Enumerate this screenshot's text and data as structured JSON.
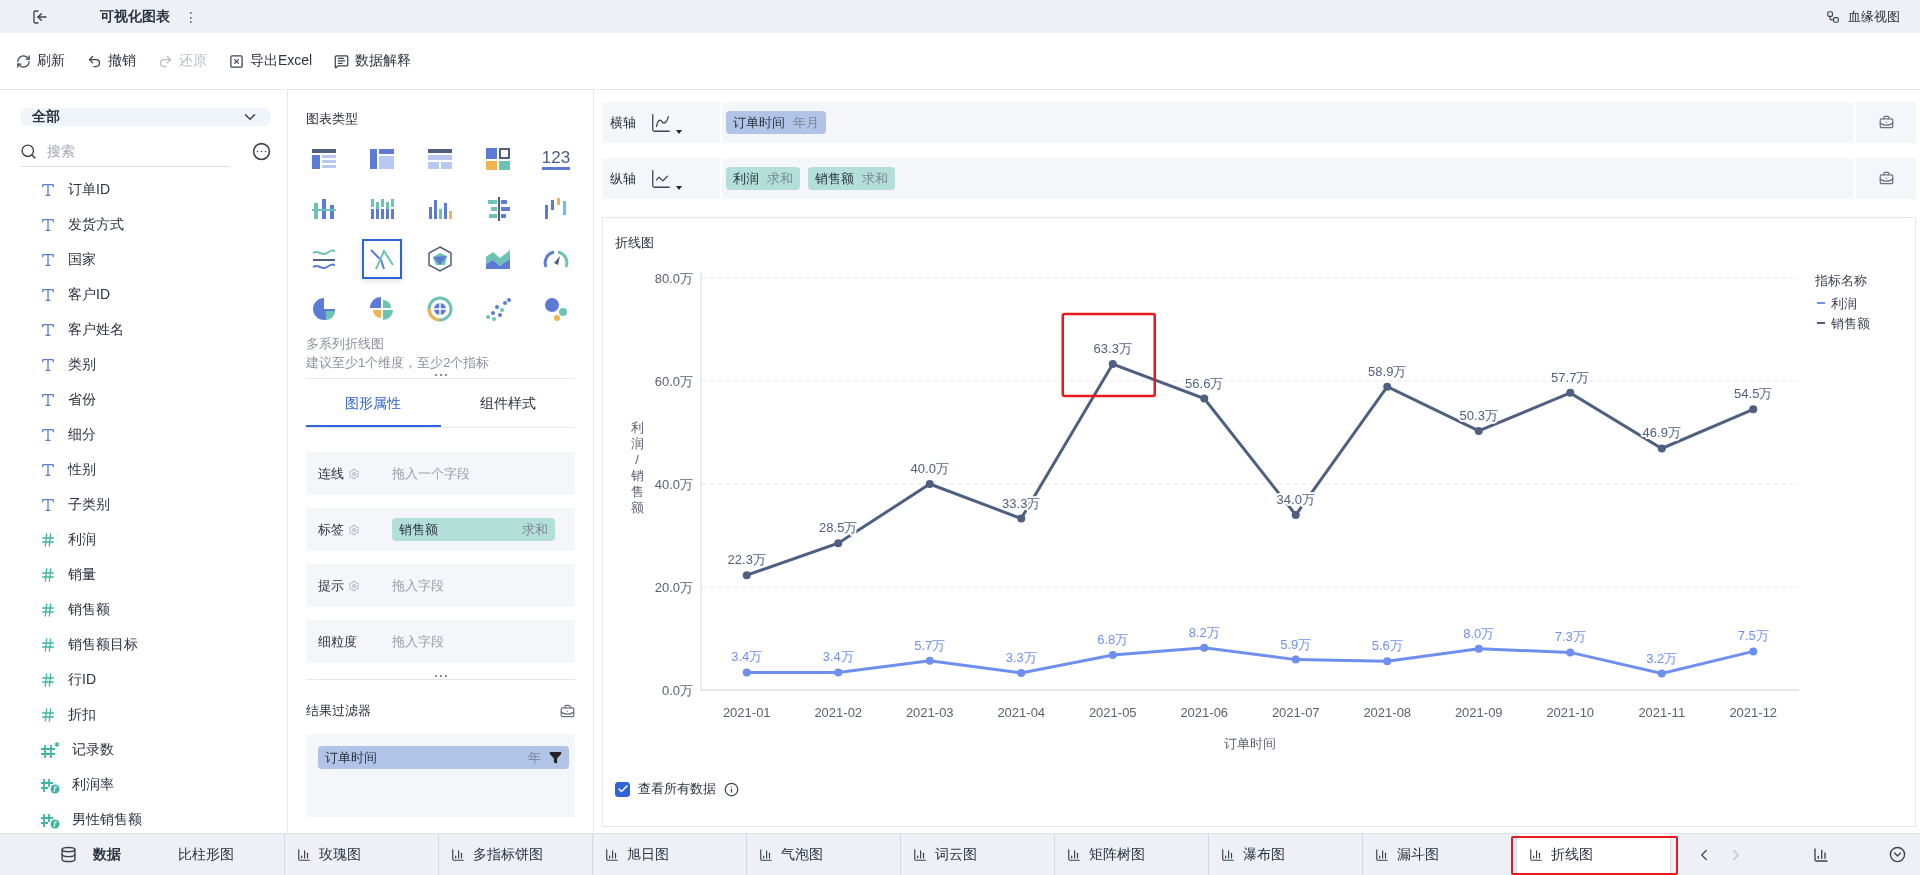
{
  "top_bar": {
    "title": "可视化图表",
    "menu_glyph": "⋮",
    "lineage_button": "血缘视图"
  },
  "toolbar": [
    {
      "label": "刷新",
      "kind": "refresh",
      "disabled": false
    },
    {
      "label": "撤销",
      "kind": "undo",
      "disabled": false
    },
    {
      "label": "还原",
      "kind": "redo",
      "disabled": true
    },
    {
      "label": "导出Excel",
      "kind": "export",
      "disabled": false
    },
    {
      "label": "数据解释",
      "kind": "explain",
      "disabled": false
    }
  ],
  "field_panel": {
    "scope": "全部",
    "search_placeholder": "搜索",
    "fields": [
      {
        "name": "订单ID",
        "kind": "dimension"
      },
      {
        "name": "发货方式",
        "kind": "dimension"
      },
      {
        "name": "国家",
        "kind": "dimension"
      },
      {
        "name": "客户ID",
        "kind": "dimension"
      },
      {
        "name": "客户姓名",
        "kind": "dimension"
      },
      {
        "name": "类别",
        "kind": "dimension"
      },
      {
        "name": "省份",
        "kind": "dimension"
      },
      {
        "name": "细分",
        "kind": "dimension"
      },
      {
        "name": "性别",
        "kind": "dimension"
      },
      {
        "name": "子类别",
        "kind": "dimension"
      },
      {
        "name": "利润",
        "kind": "measure"
      },
      {
        "name": "销量",
        "kind": "measure"
      },
      {
        "name": "销售额",
        "kind": "measure"
      },
      {
        "name": "销售额目标",
        "kind": "measure"
      },
      {
        "name": "行ID",
        "kind": "measure"
      },
      {
        "name": "折扣",
        "kind": "measure"
      },
      {
        "name": "记录数",
        "kind": "count"
      },
      {
        "name": "利润率",
        "kind": "calculated"
      },
      {
        "name": "男性销售额",
        "kind": "calculated"
      }
    ]
  },
  "chart_type_panel": {
    "title": "图表类型",
    "types": [
      {
        "kind": "table",
        "selected": false
      },
      {
        "kind": "crosstable",
        "selected": false
      },
      {
        "kind": "detail",
        "selected": false
      },
      {
        "kind": "card",
        "selected": false
      },
      {
        "kind": "number",
        "label": "123",
        "selected": false
      },
      {
        "kind": "groupbar",
        "selected": false
      },
      {
        "kind": "stackbar",
        "selected": false
      },
      {
        "kind": "multibar",
        "selected": false
      },
      {
        "kind": "comparebar",
        "selected": false
      },
      {
        "kind": "rangebar",
        "selected": false
      },
      {
        "kind": "wave",
        "selected": false
      },
      {
        "kind": "line",
        "selected": true
      },
      {
        "kind": "radar",
        "selected": false
      },
      {
        "kind": "area",
        "selected": false
      },
      {
        "kind": "gauge",
        "selected": false
      },
      {
        "kind": "pie",
        "selected": false
      },
      {
        "kind": "rose",
        "selected": false
      },
      {
        "kind": "sunburst",
        "selected": false
      },
      {
        "kind": "scatter",
        "selected": false
      },
      {
        "kind": "bubble",
        "selected": false
      }
    ],
    "description": "多系列折线图",
    "hint": "建议至少1个维度，至少2个指标",
    "tabs": [
      {
        "label": "图形属性",
        "selected": true
      },
      {
        "label": "组件样式",
        "selected": false
      }
    ],
    "properties": [
      {
        "label": "连线",
        "settings": true,
        "drop_hint": "拖入一个字段"
      },
      {
        "label": "标签",
        "settings": true,
        "field": {
          "name": "销售额",
          "agg": "求和",
          "kind": "measure"
        }
      },
      {
        "label": "提示",
        "settings": true,
        "drop_hint": "拖入字段"
      },
      {
        "label": "细粒度",
        "settings": false,
        "drop_hint": "拖入字段"
      }
    ],
    "filter": {
      "title": "结果过滤器",
      "field": {
        "name": "订单时间",
        "agg": "年",
        "kind": "dimension"
      }
    }
  },
  "axes": [
    {
      "label": "横轴",
      "fields": [
        {
          "name": "订单时间",
          "agg": "年月",
          "kind": "dimension"
        }
      ]
    },
    {
      "label": "纵轴",
      "fields": [
        {
          "name": "利润",
          "agg": "求和",
          "kind": "measure"
        },
        {
          "name": "销售额",
          "agg": "求和",
          "kind": "measure"
        }
      ]
    }
  ],
  "chart_card": {
    "title": "折线图",
    "highlight_frames": [
      {
        "category": "2021-05"
      }
    ],
    "chart_data": {
      "type": "line",
      "xlabel": "订单时间",
      "ylabel": "利润/销售额",
      "grid": true,
      "legend": {
        "title": "指标名称"
      },
      "categories": [
        "2021-01",
        "2021-02",
        "2021-03",
        "2021-04",
        "2021-05",
        "2021-06",
        "2021-07",
        "2021-08",
        "2021-09",
        "2021-10",
        "2021-11",
        "2021-12"
      ],
      "ylim": [
        0,
        80
      ],
      "yticks": [
        {
          "value": 0,
          "label": "0.0万"
        },
        {
          "value": 20,
          "label": "20.0万"
        },
        {
          "value": 40,
          "label": "40.0万"
        },
        {
          "value": 60,
          "label": "60.0万"
        },
        {
          "value": 80,
          "label": "80.0万"
        }
      ],
      "series": [
        {
          "name": "利润",
          "color": "#6f8ff0",
          "marker": "circle",
          "values": [
            3.4,
            3.4,
            5.7,
            3.3,
            6.8,
            8.2,
            5.9,
            5.6,
            8.0,
            7.3,
            3.2,
            7.5
          ],
          "value_labels": [
            "3.4万",
            "3.4万",
            "5.7万",
            "3.3万",
            "6.8万",
            "8.2万",
            "5.9万",
            "5.6万",
            "8.0万",
            "7.3万",
            "3.2万",
            "7.5万"
          ]
        },
        {
          "name": "销售额",
          "color": "#4e5f80",
          "marker": "circle",
          "values": [
            22.3,
            28.5,
            40.0,
            33.3,
            63.3,
            56.6,
            34.0,
            58.9,
            50.3,
            57.7,
            46.9,
            54.5
          ],
          "value_labels": [
            "22.3万",
            "28.5万",
            "40.0万",
            "33.3万",
            "63.3万",
            "56.6万",
            "34.0万",
            "58.9万",
            "50.3万",
            "57.7万",
            "46.9万",
            "54.5万"
          ]
        }
      ]
    },
    "show_all_data": {
      "label": "查看所有数据",
      "checked": true
    }
  },
  "bottom_bar": {
    "data_tab": "数据",
    "tabs": [
      {
        "label": "比柱形图",
        "selected": false,
        "highlighted": false
      },
      {
        "label": "玫瑰图",
        "selected": false,
        "highlighted": false
      },
      {
        "label": "多指标饼图",
        "selected": false,
        "highlighted": false
      },
      {
        "label": "旭日图",
        "selected": false,
        "highlighted": false
      },
      {
        "label": "气泡图",
        "selected": false,
        "highlighted": false
      },
      {
        "label": "词云图",
        "selected": false,
        "highlighted": false
      },
      {
        "label": "矩阵树图",
        "selected": false,
        "highlighted": false
      },
      {
        "label": "瀑布图",
        "selected": false,
        "highlighted": false
      },
      {
        "label": "漏斗图",
        "selected": false,
        "highlighted": false
      },
      {
        "label": "折线图",
        "selected": true,
        "highlighted": true
      }
    ]
  }
}
